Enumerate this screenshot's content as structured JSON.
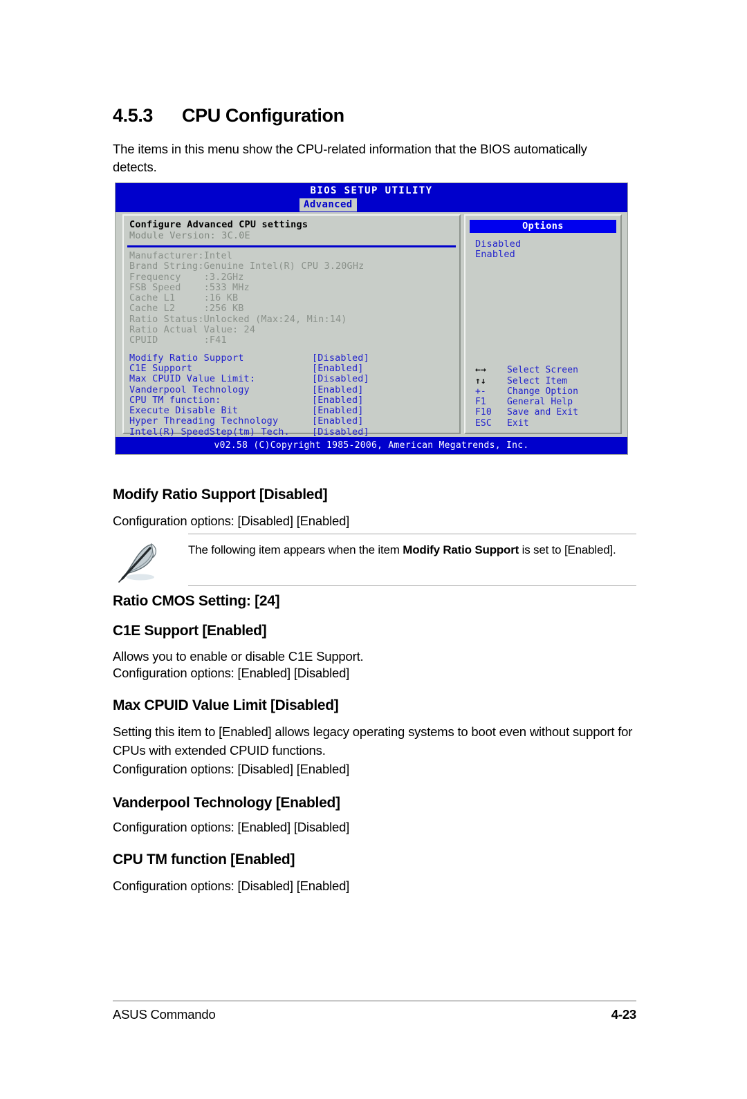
{
  "section": {
    "number": "4.5.3",
    "title": "CPU Configuration",
    "intro": "The items in this menu show the CPU-related information that the BIOS automatically detects."
  },
  "bios": {
    "title": "BIOS SETUP UTILITY",
    "tab": "Advanced",
    "config_header": "Configure Advanced CPU settings",
    "module_version": "Module Version: 3C.0E",
    "info": [
      "Manufacturer:Intel",
      "Brand String:Genuine Intel(R) CPU 3.20GHz",
      "Frequency    :3.2GHz",
      "FSB Speed    :533 MHz",
      "Cache L1     :16 KB",
      "Cache L2     :256 KB",
      "Ratio Status:Unlocked (Max:24, Min:14)",
      "Ratio Actual Value: 24",
      "CPUID        :F41"
    ],
    "settings": [
      {
        "label": "Modify Ratio Support",
        "value": "[Disabled]"
      },
      {
        "label": "C1E Support",
        "value": "[Enabled]"
      },
      {
        "label": "Max CPUID Value Limit:",
        "value": "[Disabled]"
      },
      {
        "label": "Vanderpool Technology",
        "value": "[Enabled]"
      },
      {
        "label": "CPU TM function:",
        "value": "[Enabled]"
      },
      {
        "label": "Execute Disable Bit",
        "value": "[Enabled]"
      },
      {
        "label": "Hyper Threading Technology",
        "value": "[Enabled]"
      },
      {
        "label": "Intel(R) SpeedStep(tm) Tech.",
        "value": "[Disabled]"
      }
    ],
    "options_title": "Options",
    "options": [
      "Disabled",
      "Enabled"
    ],
    "keys": [
      {
        "key": "←→",
        "desc": "Select Screen"
      },
      {
        "key": "↑↓",
        "desc": "Select Item"
      },
      {
        "key": "+-",
        "desc": "Change Option"
      },
      {
        "key": "F1",
        "desc": "General Help"
      },
      {
        "key": "F10",
        "desc": "Save and Exit"
      },
      {
        "key": "ESC",
        "desc": "Exit"
      }
    ],
    "footer": "v02.58 (C)Copyright 1985-2006, American Megatrends, Inc."
  },
  "items": {
    "modify_ratio": {
      "heading": "Modify Ratio Support [Disabled]",
      "config": "Configuration options: [Disabled] [Enabled]"
    },
    "note": {
      "text_before": "The following item appears when the item ",
      "text_bold": "Modify Ratio Support",
      "text_after": " is set to [Enabled].",
      "icon": "note-feather-icon"
    },
    "ratio_cmos": {
      "heading": "Ratio CMOS Setting: [24]"
    },
    "c1e": {
      "heading": "C1E Support [Enabled]",
      "desc": "Allows you to enable or disable C1E Support.",
      "config": "Configuration options: [Enabled] [Disabled]"
    },
    "max_cpuid": {
      "heading": "Max CPUID Value Limit [Disabled]",
      "desc": "Setting this item to [Enabled] allows legacy operating systems to boot even without support for CPUs with extended CPUID functions.",
      "config": "Configuration options: [Disabled] [Enabled]"
    },
    "vanderpool": {
      "heading": "Vanderpool Technology [Enabled]",
      "config": "Configuration options: [Enabled] [Disabled]"
    },
    "cpu_tm": {
      "heading": "CPU TM function [Enabled]",
      "config": "Configuration options: [Disabled] [Enabled]"
    }
  },
  "footer": {
    "left": "ASUS Commando",
    "right": "4-23"
  }
}
